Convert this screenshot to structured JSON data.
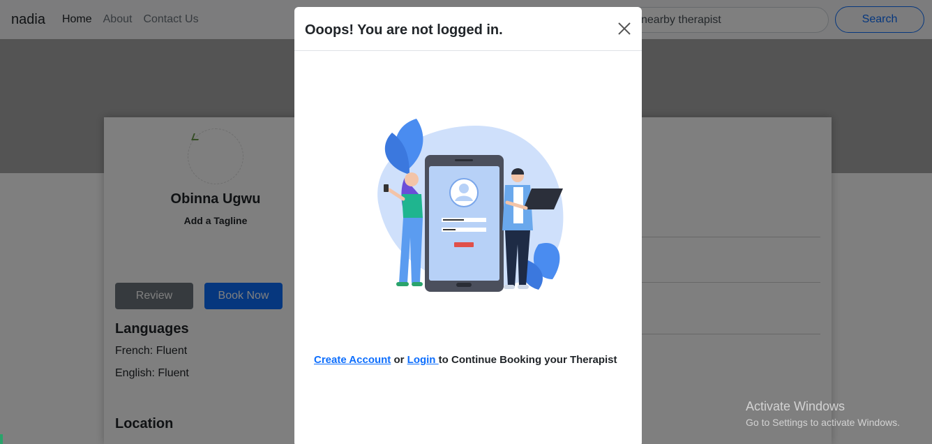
{
  "navbar": {
    "brand": "nadia",
    "links": [
      "Home",
      "About",
      "Contact Us"
    ],
    "search_placeholder": "Find nearby therapist",
    "search_value": "nearby therapist",
    "search_button": "Search"
  },
  "profile": {
    "name": "Obinna Ugwu",
    "tagline": "Add a Tagline",
    "review_button": "Review",
    "book_button": "Book Now",
    "languages_title": "Languages",
    "languages": [
      "French: Fluent",
      "English: Fluent"
    ],
    "location_title": "Location"
  },
  "modal": {
    "title": "Ooops! You are not logged in.",
    "create_account_link": "Create Account",
    "or_text": "or",
    "login_link": "Login ",
    "continue_text": "to Continue Booking your Therapist",
    "illustration": "login-illustration",
    "close_icon": "close-icon"
  },
  "watermark": {
    "title": "Activate Windows",
    "subtitle": "Go to Settings to activate Windows."
  },
  "colors": {
    "primary": "#0d6efd",
    "secondary": "#6c757d",
    "hero": "#a9a9a9",
    "illustration_blue": "#4a8cf0",
    "illustration_light": "#cfe0fb"
  }
}
